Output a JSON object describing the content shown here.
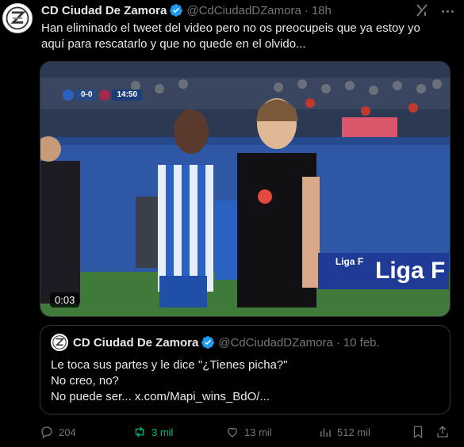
{
  "tweet": {
    "author_name": "CD Ciudad De Zamora",
    "author_handle": "@CdCiudadDZamora",
    "separator": "·",
    "time": "18h",
    "text_line1": "Han eliminado el tweet del video pero no os preocupeis que ya estoy yo",
    "text_line2": "aquí para rescatarlo y que no quede en el olvido..."
  },
  "video": {
    "duration": "0:03",
    "score": "0-0",
    "clock": "14:50",
    "ad_board_small": "Liga F",
    "ad_board_large": "Liga F"
  },
  "quote": {
    "author_name": "CD Ciudad De Zamora",
    "author_handle": "@CdCiudadDZamora",
    "separator": "·",
    "time": "10 feb.",
    "line1": "Le toca sus partes y le dice \"¿Tienes picha?\"",
    "line2": "No creo, no?",
    "line3": "No puede ser... x.com/Mapi_wins_BdO/..."
  },
  "actions": {
    "replies": "204",
    "retweets": "3 mil",
    "likes": "13 mil",
    "views": "512 mil"
  },
  "colors": {
    "background": "#000000",
    "text": "#e7e9ea",
    "muted": "#71767b",
    "border": "#2f3336",
    "verified": "#1d9bf0",
    "retweet_active": "#00ba7c"
  }
}
